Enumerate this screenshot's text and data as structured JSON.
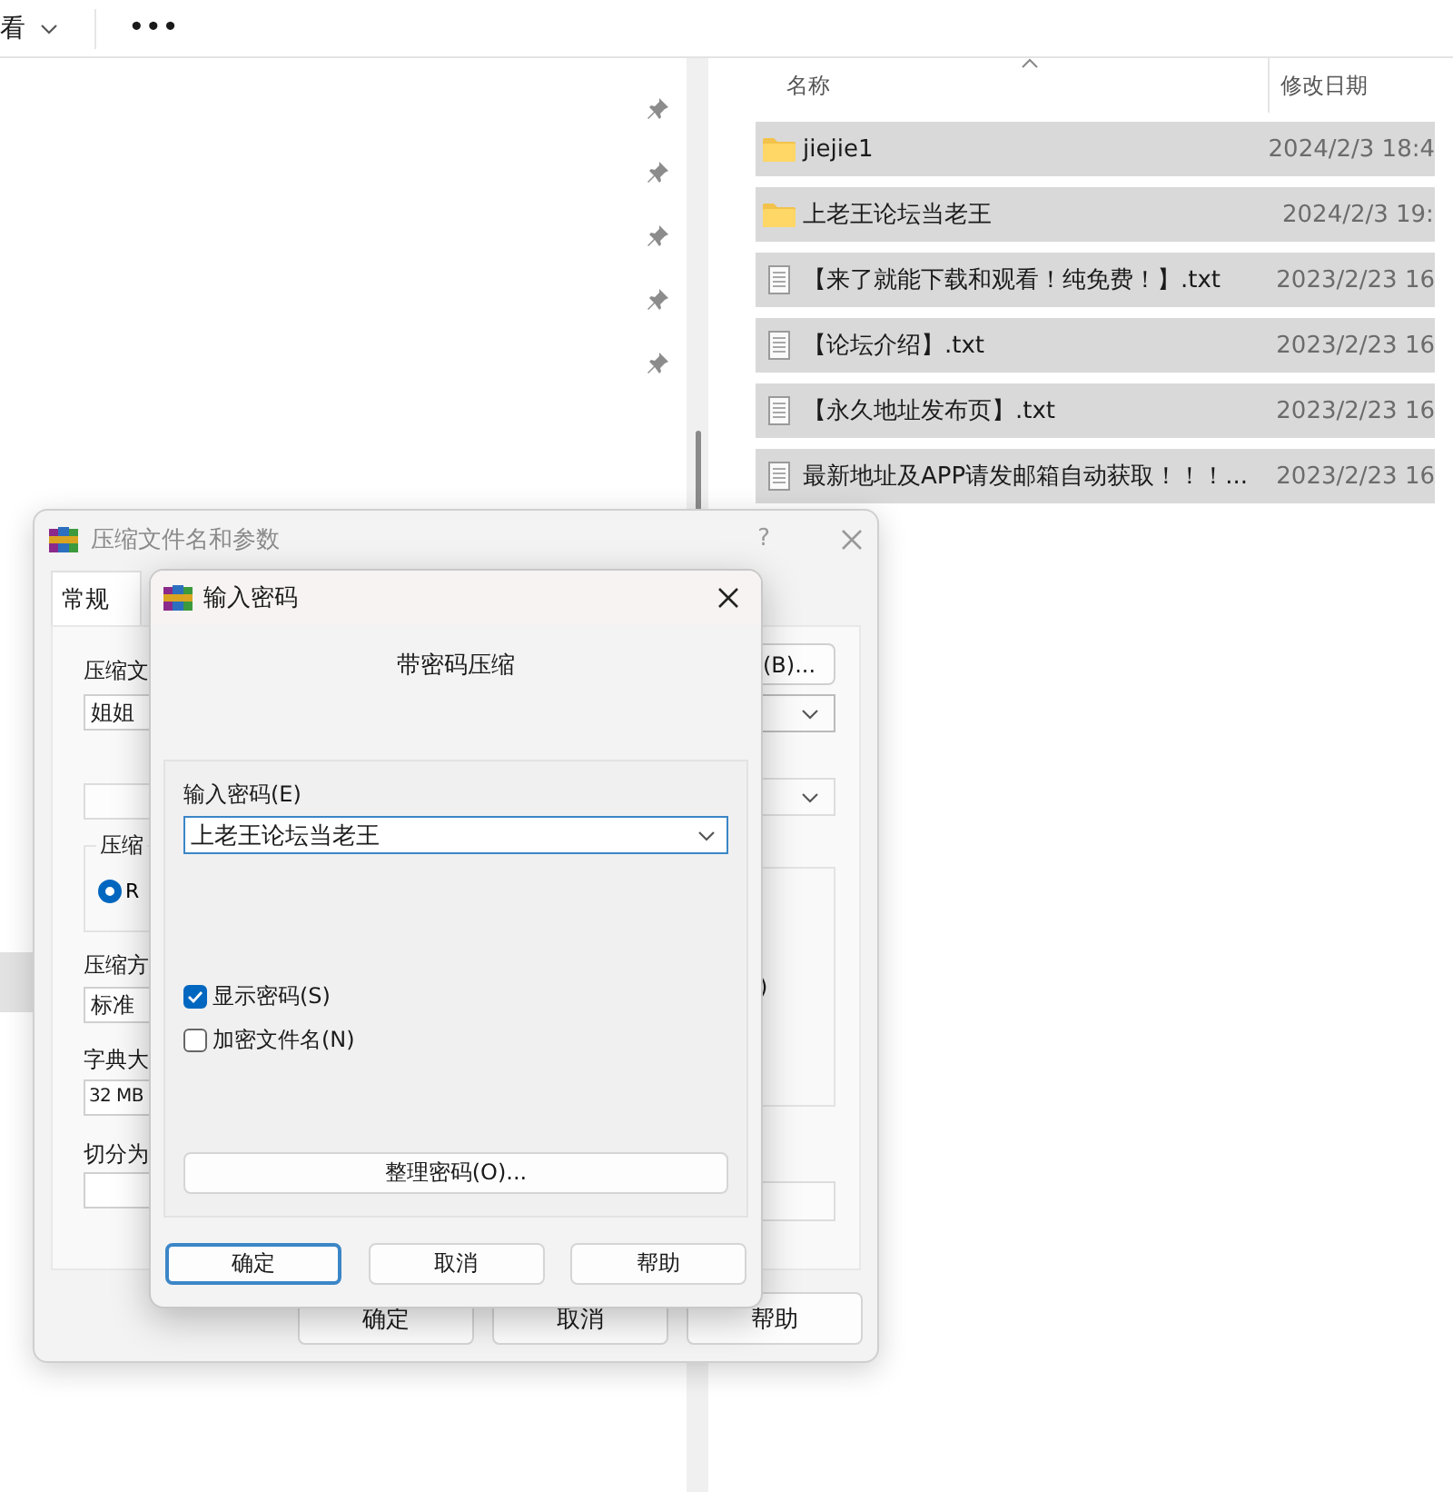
{
  "explorer": {
    "toolbar": {
      "view_menu": "看",
      "more_menu": "•••"
    },
    "columns": [
      "名称",
      "修改日期"
    ],
    "files": [
      {
        "kind": "folder",
        "name": "jiejie1",
        "date": "2024/2/3 18:4",
        "selected": true
      },
      {
        "kind": "folder",
        "name": "上老王论坛当老王",
        "date": "2024/2/3 19:",
        "selected": true
      },
      {
        "kind": "text",
        "name": "【来了就能下载和观看！纯免费！】.txt",
        "date": "2023/2/23 16",
        "selected": true
      },
      {
        "kind": "text",
        "name": "【论坛介绍】.txt",
        "date": "2023/2/23 16",
        "selected": true
      },
      {
        "kind": "text",
        "name": "【永久地址发布页】.txt",
        "date": "2023/2/23 16",
        "selected": true
      },
      {
        "kind": "text",
        "name": "最新地址及APP请发邮箱自动获取！！！...",
        "date": "2023/2/23 16",
        "selected": true
      }
    ]
  },
  "archive_dialog": {
    "title": "压缩文件名和参数",
    "help": "?",
    "tabs": [
      {
        "label": "常规",
        "selected": true
      }
    ],
    "archive_name_label": "压缩文",
    "browse_button": "(B)...",
    "archive_name_value": "姐姐",
    "format_label": "压缩",
    "format_options": [
      {
        "label": "R",
        "selected": true
      }
    ],
    "method_label": "压缩方",
    "method_value": "标准",
    "dictionary_label": "字典大",
    "dictionary_value": "32 MB",
    "split_label": "切分为",
    "group_fragment": ")",
    "buttons": [
      "确定",
      "取消",
      "帮助"
    ]
  },
  "password_dialog": {
    "title": "输入密码",
    "heading": "带密码压缩",
    "password_label": "输入密码(E)",
    "password_value": "上老王论坛当老王",
    "options": [
      {
        "label": "显示密码(S)",
        "checked": true
      },
      {
        "label": "加密文件名(N)",
        "checked": false
      }
    ],
    "organize_button": "整理密码(O)...",
    "buttons": [
      {
        "label": "确定",
        "default": true
      },
      {
        "label": "取消",
        "default": false
      },
      {
        "label": "帮助",
        "default": false
      }
    ]
  }
}
